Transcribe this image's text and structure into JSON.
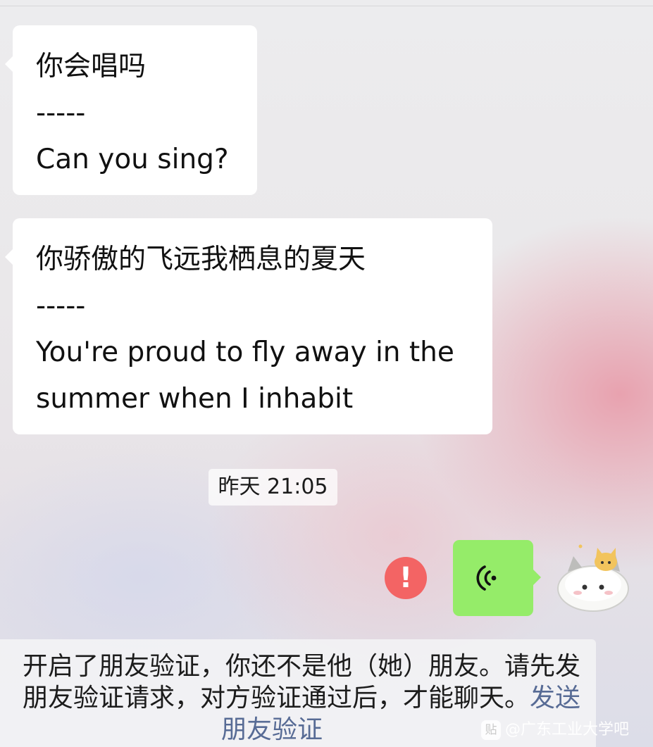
{
  "messages": [
    {
      "lines": [
        "你会唱吗",
        "-----",
        "Can you sing?"
      ]
    },
    {
      "lines": [
        "你骄傲的飞远我栖息的夏天",
        "-----",
        "You're proud to fly away in the",
        "summer when I inhabit"
      ]
    }
  ],
  "timestamp": "昨天 21:05",
  "outgoing": {
    "error_mark": "!",
    "voice_icon": "voice-wave-icon",
    "bubble_color": "#95ec69"
  },
  "notice": {
    "line1": "开启了朋友验证，你还不是他（她）朋友。请先发",
    "line2": "朋友验证请求，对方验证通过后，才能聊天。",
    "link_part1": "发送",
    "link_part2": "朋友验证",
    "link_color": "#576b95"
  },
  "watermark": {
    "icon_text": "贴",
    "text": "@广东工业大学吧"
  },
  "colors": {
    "error": "#f36464",
    "bubble": "#ffffff"
  }
}
